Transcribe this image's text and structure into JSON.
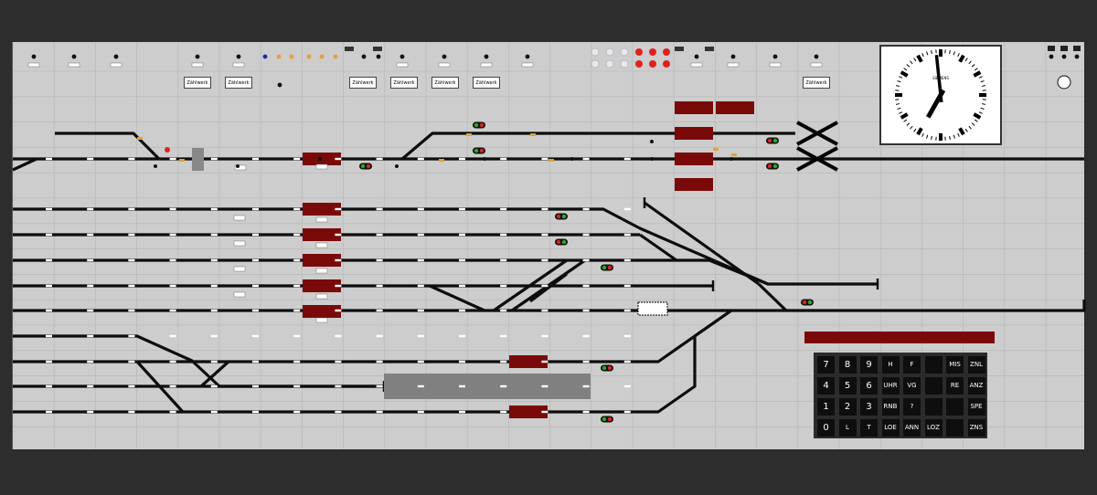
{
  "colors": {
    "panel": "#cdcdcd",
    "frame": "#2d2d2d",
    "track": "#0d0d0d",
    "occupied_block": "#7a0a0a",
    "platform": "#808080",
    "switch_point": "#e8a030",
    "signal_red": "#e02020",
    "signal_green": "#20b020",
    "indicator_blue": "#1a2ea0"
  },
  "counters": {
    "label": "Zählwerk",
    "items": [
      "Zählwerk",
      "Zählwerk",
      "Zählwerk",
      "Zählwerk",
      "Zählwerk",
      "Zählwerk",
      "Zählwerk"
    ]
  },
  "keypad": {
    "rows": [
      [
        "7",
        "8",
        "9",
        "H",
        "F",
        "",
        "MIS",
        "ZNL"
      ],
      [
        "4",
        "5",
        "6",
        "UHR",
        "VG",
        "",
        "RE",
        "ANZ"
      ],
      [
        "1",
        "2",
        "3",
        "RNB",
        "?",
        "",
        "",
        "SPE"
      ],
      [
        "0",
        "L",
        "T",
        "LOE",
        "ANN",
        "LOZ",
        "",
        "ZNS"
      ]
    ]
  },
  "clock": {
    "brand": "SIEMENS",
    "hour": 6,
    "minute": 59
  },
  "icons": [
    "signal-icon",
    "switch-icon",
    "bumper-icon",
    "crossing-icon",
    "clock-icon",
    "counter-icon"
  ]
}
